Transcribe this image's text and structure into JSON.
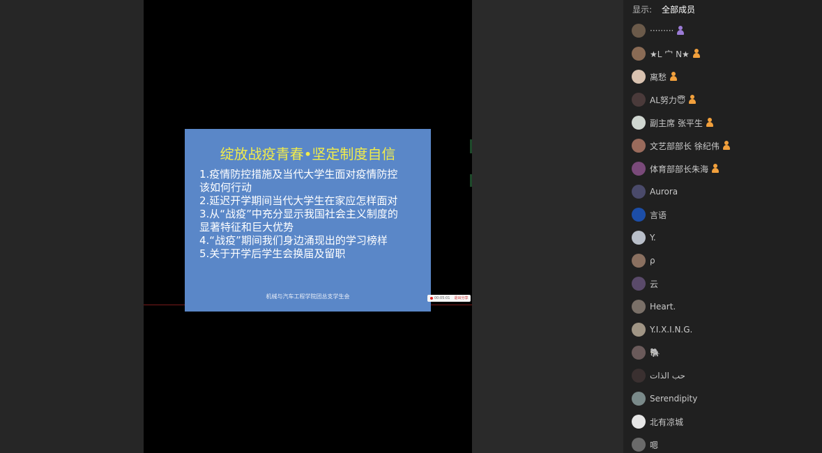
{
  "slide": {
    "title": "绽放战疫青春•坚定制度自信",
    "items": [
      "1.疫情防控措施及当代大学生面对疫情防控该如何行动",
      "2.延迟开学期间当代大学生在家应怎样面对",
      "3.从“战疫”中充分显示我国社会主义制度的显著特征和巨大优势",
      "4.“战疫”期间我们身边涌现出的学习榜样",
      "5.关于开学后学生会换届及留职"
    ],
    "footer": "机械与汽车工程学院团总支学生会"
  },
  "recorder": {
    "time": "00:05:01",
    "stop_label": "退出分享"
  },
  "members_panel": {
    "filter_label": "显示:",
    "filter_value": "全部成员",
    "members": [
      {
        "name": "·········",
        "badge": "admin",
        "avatar_color": "#6b5a4a"
      },
      {
        "name": "★L 宀  N★",
        "badge": "host",
        "avatar_color": "#8a6b55"
      },
      {
        "name": "离愁",
        "badge": "host",
        "avatar_color": "#d9c2b0"
      },
      {
        "name": "AL努力😇",
        "badge": "host",
        "avatar_color": "#4a3a3a"
      },
      {
        "name": "副主席 张平生",
        "badge": "host",
        "avatar_color": "#cfd6d0"
      },
      {
        "name": "文艺部部长 徐纪伟",
        "badge": "host",
        "avatar_color": "#9a6b5c"
      },
      {
        "name": "体育部部长朱海",
        "badge": "host",
        "avatar_color": "#7a4a7a"
      },
      {
        "name": "Aurora",
        "badge": "",
        "avatar_color": "#4a4a6a"
      },
      {
        "name": "言语",
        "badge": "",
        "avatar_color": "#1c4ea8"
      },
      {
        "name": "Y.",
        "badge": "",
        "avatar_color": "#b9bfc9"
      },
      {
        "name": "ρ",
        "badge": "",
        "avatar_color": "#8a7060"
      },
      {
        "name": "云",
        "badge": "",
        "avatar_color": "#5a4a6a"
      },
      {
        "name": "Heart.",
        "badge": "",
        "avatar_color": "#7a7068"
      },
      {
        "name": "Y.I.X.I.N.G.",
        "badge": "",
        "avatar_color": "#a09585"
      },
      {
        "name": "🐘",
        "badge": "",
        "avatar_color": "#6a5a5a"
      },
      {
        "name": "حب الذات",
        "badge": "",
        "avatar_color": "#3a3030"
      },
      {
        "name": "Serendipity",
        "badge": "",
        "avatar_color": "#7a8a8a"
      },
      {
        "name": "北有凉城",
        "badge": "",
        "avatar_color": "#e6e6e6"
      },
      {
        "name": "嗯",
        "badge": "",
        "avatar_color": "#6a6a6a"
      }
    ]
  },
  "colors": {
    "slide_bg": "#5a87c8",
    "slide_title": "#f2ec4a",
    "admin_badge": "#9b7bd6",
    "host_badge": "#f2a03c"
  }
}
